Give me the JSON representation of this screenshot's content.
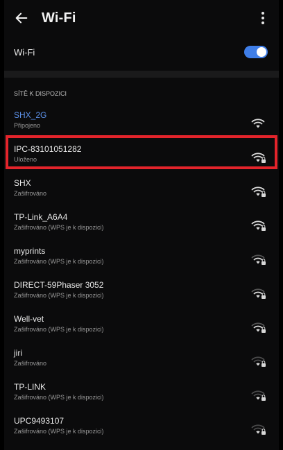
{
  "header": {
    "title": "Wi-Fi"
  },
  "toggle": {
    "label": "Wi-Fi"
  },
  "section": {
    "title": "SÍTĚ K DISPOZICI"
  },
  "networks": [
    {
      "name": "SHX_2G",
      "status": "Připojeno",
      "connected": true,
      "highlighted": false,
      "signal": "strong"
    },
    {
      "name": "IPC-83101051282",
      "status": "Uloženo",
      "connected": false,
      "highlighted": true,
      "signal": "strong"
    },
    {
      "name": "SHX",
      "status": "Zašifrováno",
      "connected": false,
      "highlighted": false,
      "signal": "strong"
    },
    {
      "name": "TP-Link_A6A4",
      "status": "Zašifrováno (WPS je k dispozici)",
      "connected": false,
      "highlighted": false,
      "signal": "strong"
    },
    {
      "name": "myprints",
      "status": "Zašifrováno (WPS je k dispozici)",
      "connected": false,
      "highlighted": false,
      "signal": "medium"
    },
    {
      "name": "DIRECT-59Phaser 3052",
      "status": "Zašifrováno (WPS je k dispozici)",
      "connected": false,
      "highlighted": false,
      "signal": "medium"
    },
    {
      "name": "Well-vet",
      "status": "Zašifrováno (WPS je k dispozici)",
      "connected": false,
      "highlighted": false,
      "signal": "medium"
    },
    {
      "name": "jiri",
      "status": "Zašifrováno",
      "connected": false,
      "highlighted": false,
      "signal": "weak"
    },
    {
      "name": "TP-LINK",
      "status": "Zašifrováno (WPS je k dispozici)",
      "connected": false,
      "highlighted": false,
      "signal": "weak"
    },
    {
      "name": "UPC9493107",
      "status": "Zašifrováno (WPS je k dispozici)",
      "connected": false,
      "highlighted": false,
      "signal": "weak"
    }
  ],
  "colors": {
    "accent": "#3f7ee8",
    "connected": "#5b8fe6",
    "highlight": "#e3242b"
  },
  "icons": [
    "back-arrow-icon",
    "more-vert-icon",
    "wifi-signal-icon",
    "lock-icon"
  ]
}
